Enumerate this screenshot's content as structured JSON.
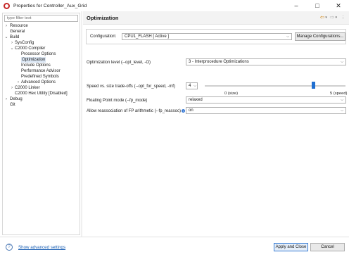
{
  "window": {
    "title": "Properties for Controller_Aux_Grid",
    "app_icon": "ccs-app-icon"
  },
  "filter": {
    "placeholder": "type filter text",
    "value": ""
  },
  "tree": [
    {
      "label": "Resource",
      "level": 0,
      "toggle": "›",
      "selected": false
    },
    {
      "label": "General",
      "level": 0,
      "toggle": "",
      "selected": false
    },
    {
      "label": "Build",
      "level": 0,
      "toggle": "⌄",
      "selected": false
    },
    {
      "label": "SysConfig",
      "level": 1,
      "toggle": "›",
      "selected": false
    },
    {
      "label": "C2000 Compiler",
      "level": 1,
      "toggle": "⌄",
      "selected": false
    },
    {
      "label": "Processor Options",
      "level": 2,
      "toggle": "",
      "selected": false
    },
    {
      "label": "Optimization",
      "level": 2,
      "toggle": "",
      "selected": true
    },
    {
      "label": "Include Options",
      "level": 2,
      "toggle": "",
      "selected": false
    },
    {
      "label": "Performance Advisor",
      "level": 2,
      "toggle": "",
      "selected": false
    },
    {
      "label": "Predefined Symbols",
      "level": 2,
      "toggle": "",
      "selected": false
    },
    {
      "label": "Advanced Options",
      "level": 2,
      "toggle": "›",
      "selected": false
    },
    {
      "label": "C2000 Linker",
      "level": 1,
      "toggle": "›",
      "selected": false
    },
    {
      "label": "C2000 Hex Utility  [Disabled]",
      "level": 1,
      "toggle": "",
      "selected": false
    },
    {
      "label": "Debug",
      "level": 0,
      "toggle": "›",
      "selected": false
    },
    {
      "label": "Git",
      "level": 0,
      "toggle": "",
      "selected": false
    }
  ],
  "page": {
    "title": "Optimization"
  },
  "configuration": {
    "label": "Configuration:",
    "value": "CPU1_FLASH  [ Active ]",
    "manage_button": "Manage Configurations..."
  },
  "options": {
    "opt_level": {
      "label": "Optimization level (--opt_level, -O)",
      "value": "3 - Interprocedure Optimizations"
    },
    "opt_for_speed": {
      "label": "Speed vs. size trade-offs (--opt_for_speed, -mf)",
      "value": "4",
      "slider_min_label": "0 (size)",
      "slider_max_label": "5 (speed)",
      "slider_level": 4,
      "slider_max": 5
    },
    "fp_mode": {
      "label": "Floating Point mode (--fp_mode)",
      "value": "relaxed"
    },
    "fp_reassoc": {
      "label": "Allow reassociation of FP arithmetic (--fp_reassoc)",
      "value": "on"
    }
  },
  "footer": {
    "advanced_link": "Show advanced settings",
    "apply_close": "Apply and Close",
    "cancel": "Cancel"
  },
  "colors": {
    "accent": "#1f6fd1",
    "selection": "#dbe6f3",
    "nav_arrow": "#d08a1a"
  }
}
